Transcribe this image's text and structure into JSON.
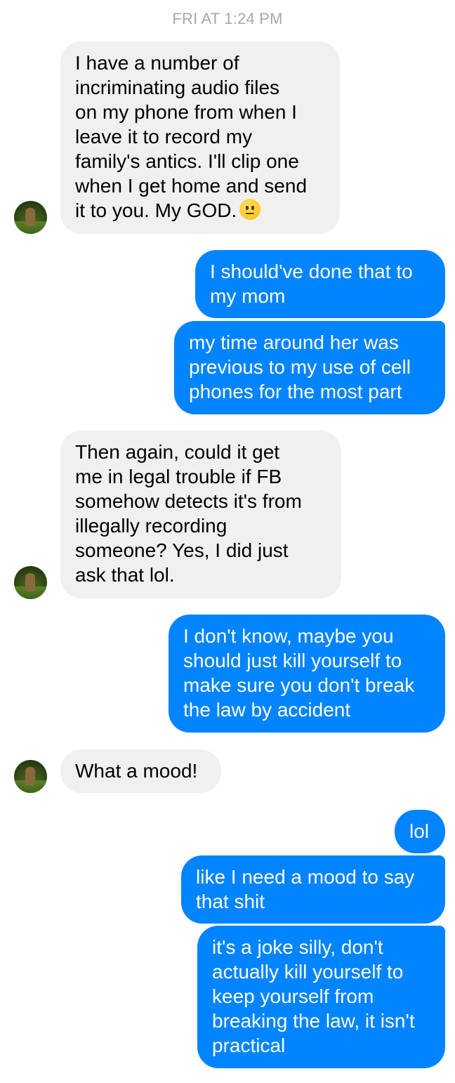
{
  "conversation": {
    "timestamp": "FRI AT 1:24 PM",
    "messages": [
      {
        "direction": "incoming",
        "text": "I have a number of\nincriminating audio files\non my phone from when I\nleave it to record my\nfamily's antics. I'll clip one\nwhen I get home and send\nit to you. My GOD.",
        "emoji": "neutral-face-emoji"
      },
      {
        "direction": "outgoing",
        "text": "I should've done that to\nmy mom"
      },
      {
        "direction": "outgoing",
        "text": "my time around her was\nprevious to my use of cell\nphones for the most part"
      },
      {
        "direction": "incoming",
        "text": "Then again, could it get\nme in legal trouble if FB\nsomehow detects it's from\nillegally recording\nsomeone? Yes, I did just\nask that lol."
      },
      {
        "direction": "outgoing",
        "text": "I don't know, maybe you\nshould just kill yourself to\nmake sure you don't break\nthe law by accident"
      },
      {
        "direction": "incoming",
        "text": "What a mood!"
      },
      {
        "direction": "outgoing",
        "text": "lol"
      },
      {
        "direction": "outgoing",
        "text": "like I need a mood to say\nthat shit"
      },
      {
        "direction": "outgoing",
        "text": "it's a joke silly, don't\nactually kill yourself to\nkeep yourself from\nbreaking the law, it isn't\npractical"
      }
    ]
  },
  "colors": {
    "incoming_bubble": "#f1f0f0",
    "outgoing_bubble": "#0084ff",
    "timestamp_text": "#a8a8a8"
  }
}
